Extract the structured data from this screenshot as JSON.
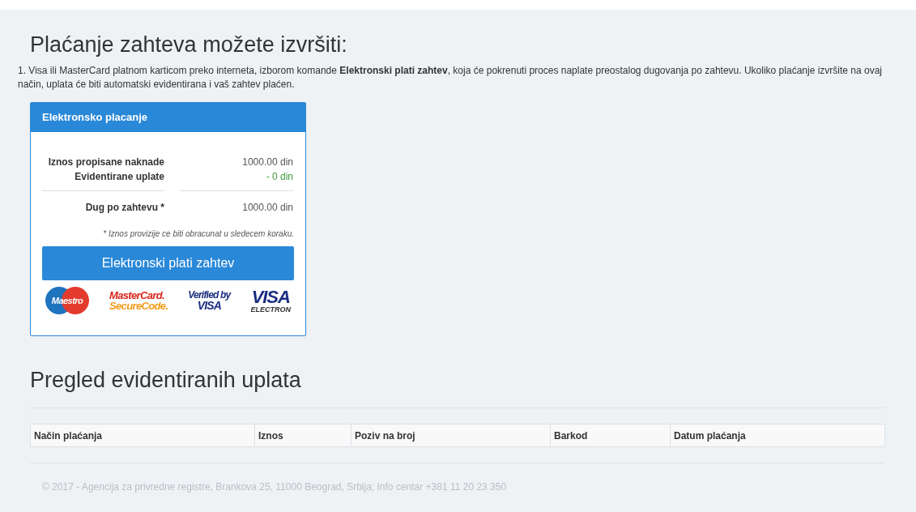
{
  "title": "Plaćanje zahteva možete izvršiti:",
  "intro": "1. Visa ili MasterCard platnom karticom preko interneta, izborom komande **Elektronski plati zahtev**, koja će pokrenuti proces naplate preostalog dugovanja po zahtevu. Ukoliko plaćanje izvršite na ovaj način, uplata će biti automatski evidentirana i vaš zahtev plaćen.",
  "payment_card": {
    "title": "Elektronsko placanje",
    "lines": [
      {
        "label": "Iznos propisane naknade",
        "value": "1000.00 din",
        "kind": "normal"
      },
      {
        "label": "Evidentirane uplate",
        "value": "- 0 din",
        "kind": "credit"
      }
    ],
    "total": {
      "label": "Dug po zahtevu *",
      "value": "1000.00 din"
    },
    "note": "* Iznos provizije ce biti obracunat u sledecem koraku.",
    "button": "Elektronski plati zahtev",
    "logos": [
      {
        "kind": "maestro",
        "text": [
          "Maestro"
        ]
      },
      {
        "kind": "mastercard",
        "text": [
          "MasterCard.",
          "SecureCode."
        ]
      },
      {
        "kind": "verified",
        "text": [
          "Verified by",
          "VISA"
        ]
      },
      {
        "kind": "visa_electron",
        "text": [
          "VISA",
          "ELECTRON"
        ]
      }
    ]
  },
  "payments_title": "Pregled evidentiranih uplata",
  "table": {
    "columns": [
      "Način plaćanja",
      "Iznos",
      "Poziv na broj",
      "Barkod",
      "Datum plaćanja"
    ]
  },
  "footer": "© 2017 - Agencija za privredne registre, Brankova 25, 11000 Beograd, Srbija; Info centar +381 11 20 23 350"
}
